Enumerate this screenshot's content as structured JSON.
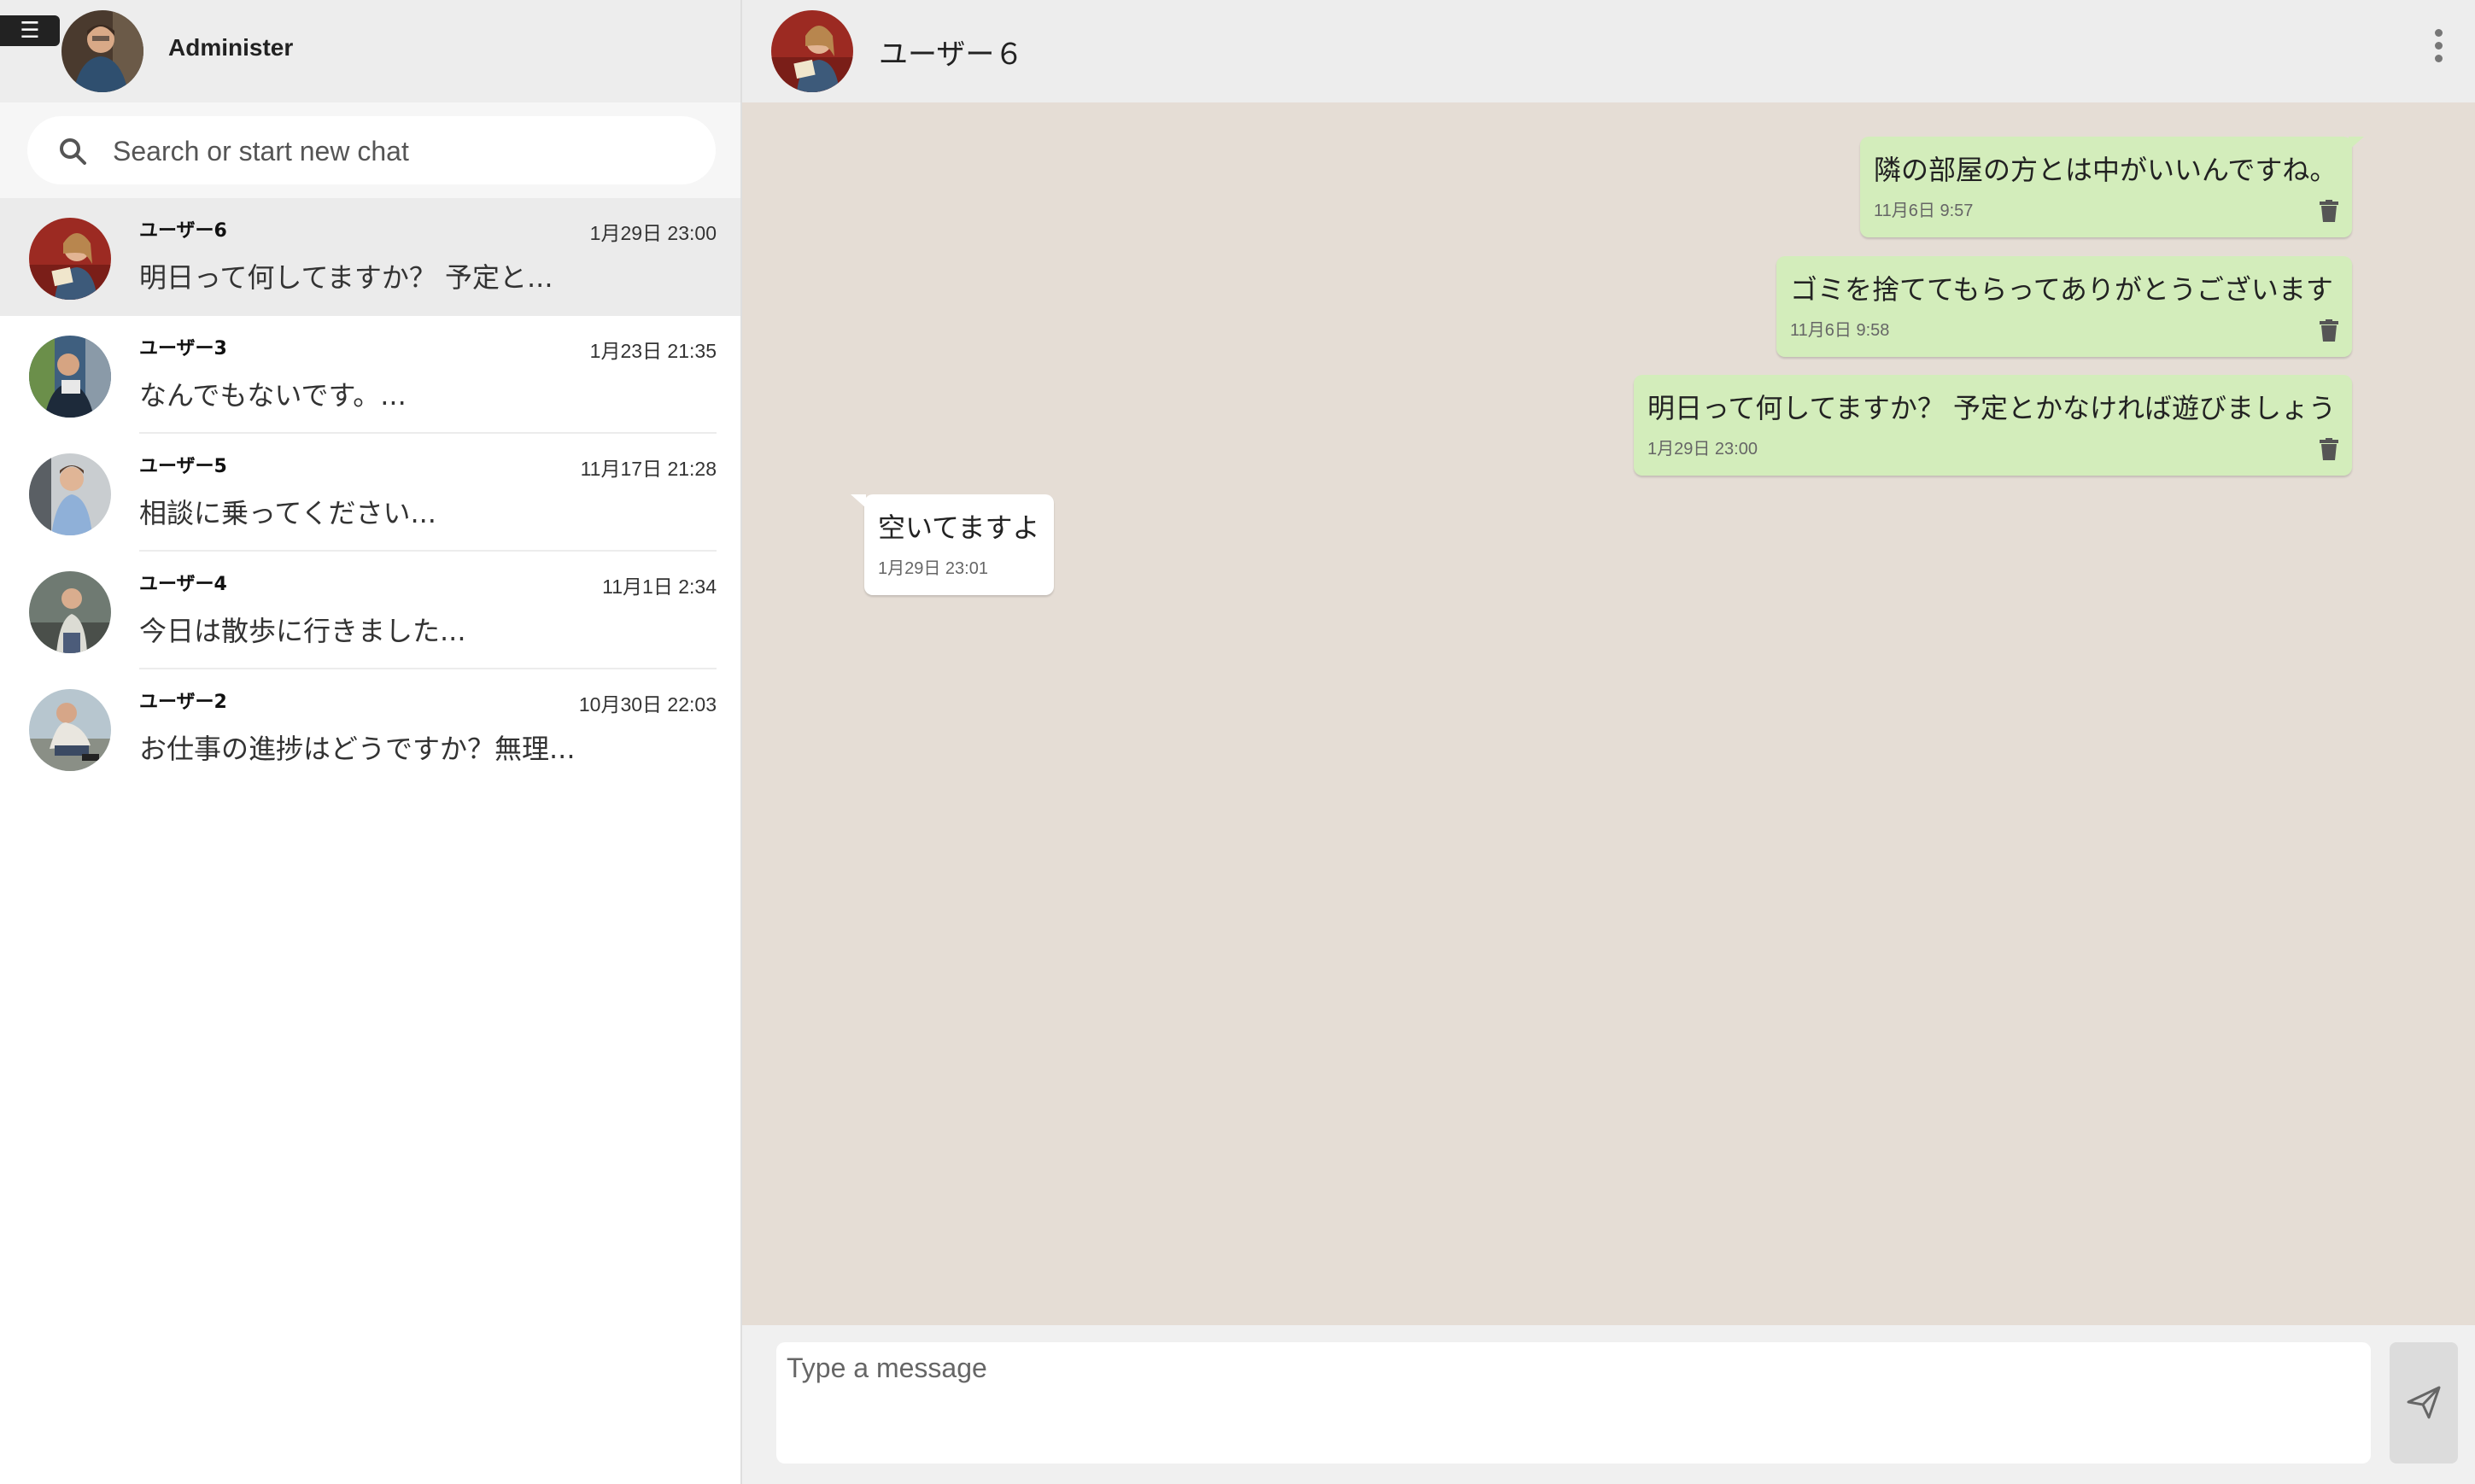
{
  "sidebar": {
    "menu_glyph": "☰",
    "me": {
      "name": "Administer",
      "avatar_icon": "user-avatar"
    },
    "search": {
      "placeholder": "Search or start new chat"
    },
    "chats": [
      {
        "name": "ユーザー6",
        "time": "1月29日 23:00",
        "preview": "明日って何してますか？ 予定と...",
        "active": true
      },
      {
        "name": "ユーザー3",
        "time": "1月23日 21:35",
        "preview": "なんでもないです。...",
        "active": false
      },
      {
        "name": "ユーザー5",
        "time": "11月17日 21:28",
        "preview": "相談に乗ってください...",
        "active": false
      },
      {
        "name": "ユーザー4",
        "time": "11月1日 2:34",
        "preview": "今日は散歩に行きました...",
        "active": false
      },
      {
        "name": "ユーザー2",
        "time": "10月30日 22:03",
        "preview": "お仕事の進捗はどうですか？無理...",
        "active": false
      }
    ]
  },
  "conversation": {
    "title": "ユーザー６",
    "messages": [
      {
        "direction": "out",
        "text": "隣の部屋の方とは中がいいんですね。",
        "time": "11月6日 9:57"
      },
      {
        "direction": "out",
        "text": "ゴミを捨ててもらってありがとうございます",
        "time": "11月6日 9:58"
      },
      {
        "direction": "out",
        "text": "明日って何してますか？ 予定とかなければ遊びましょう",
        "time": "1月29日 23:00"
      },
      {
        "direction": "in",
        "text": "空いてますよ",
        "time": "1月29日 23:01"
      }
    ],
    "composer": {
      "placeholder": "Type a message"
    }
  },
  "colors": {
    "outgoing_bubble": "#d3edbb",
    "incoming_bubble": "#ffffff",
    "chat_background": "#e5ddd5",
    "header_background": "#ededed"
  }
}
